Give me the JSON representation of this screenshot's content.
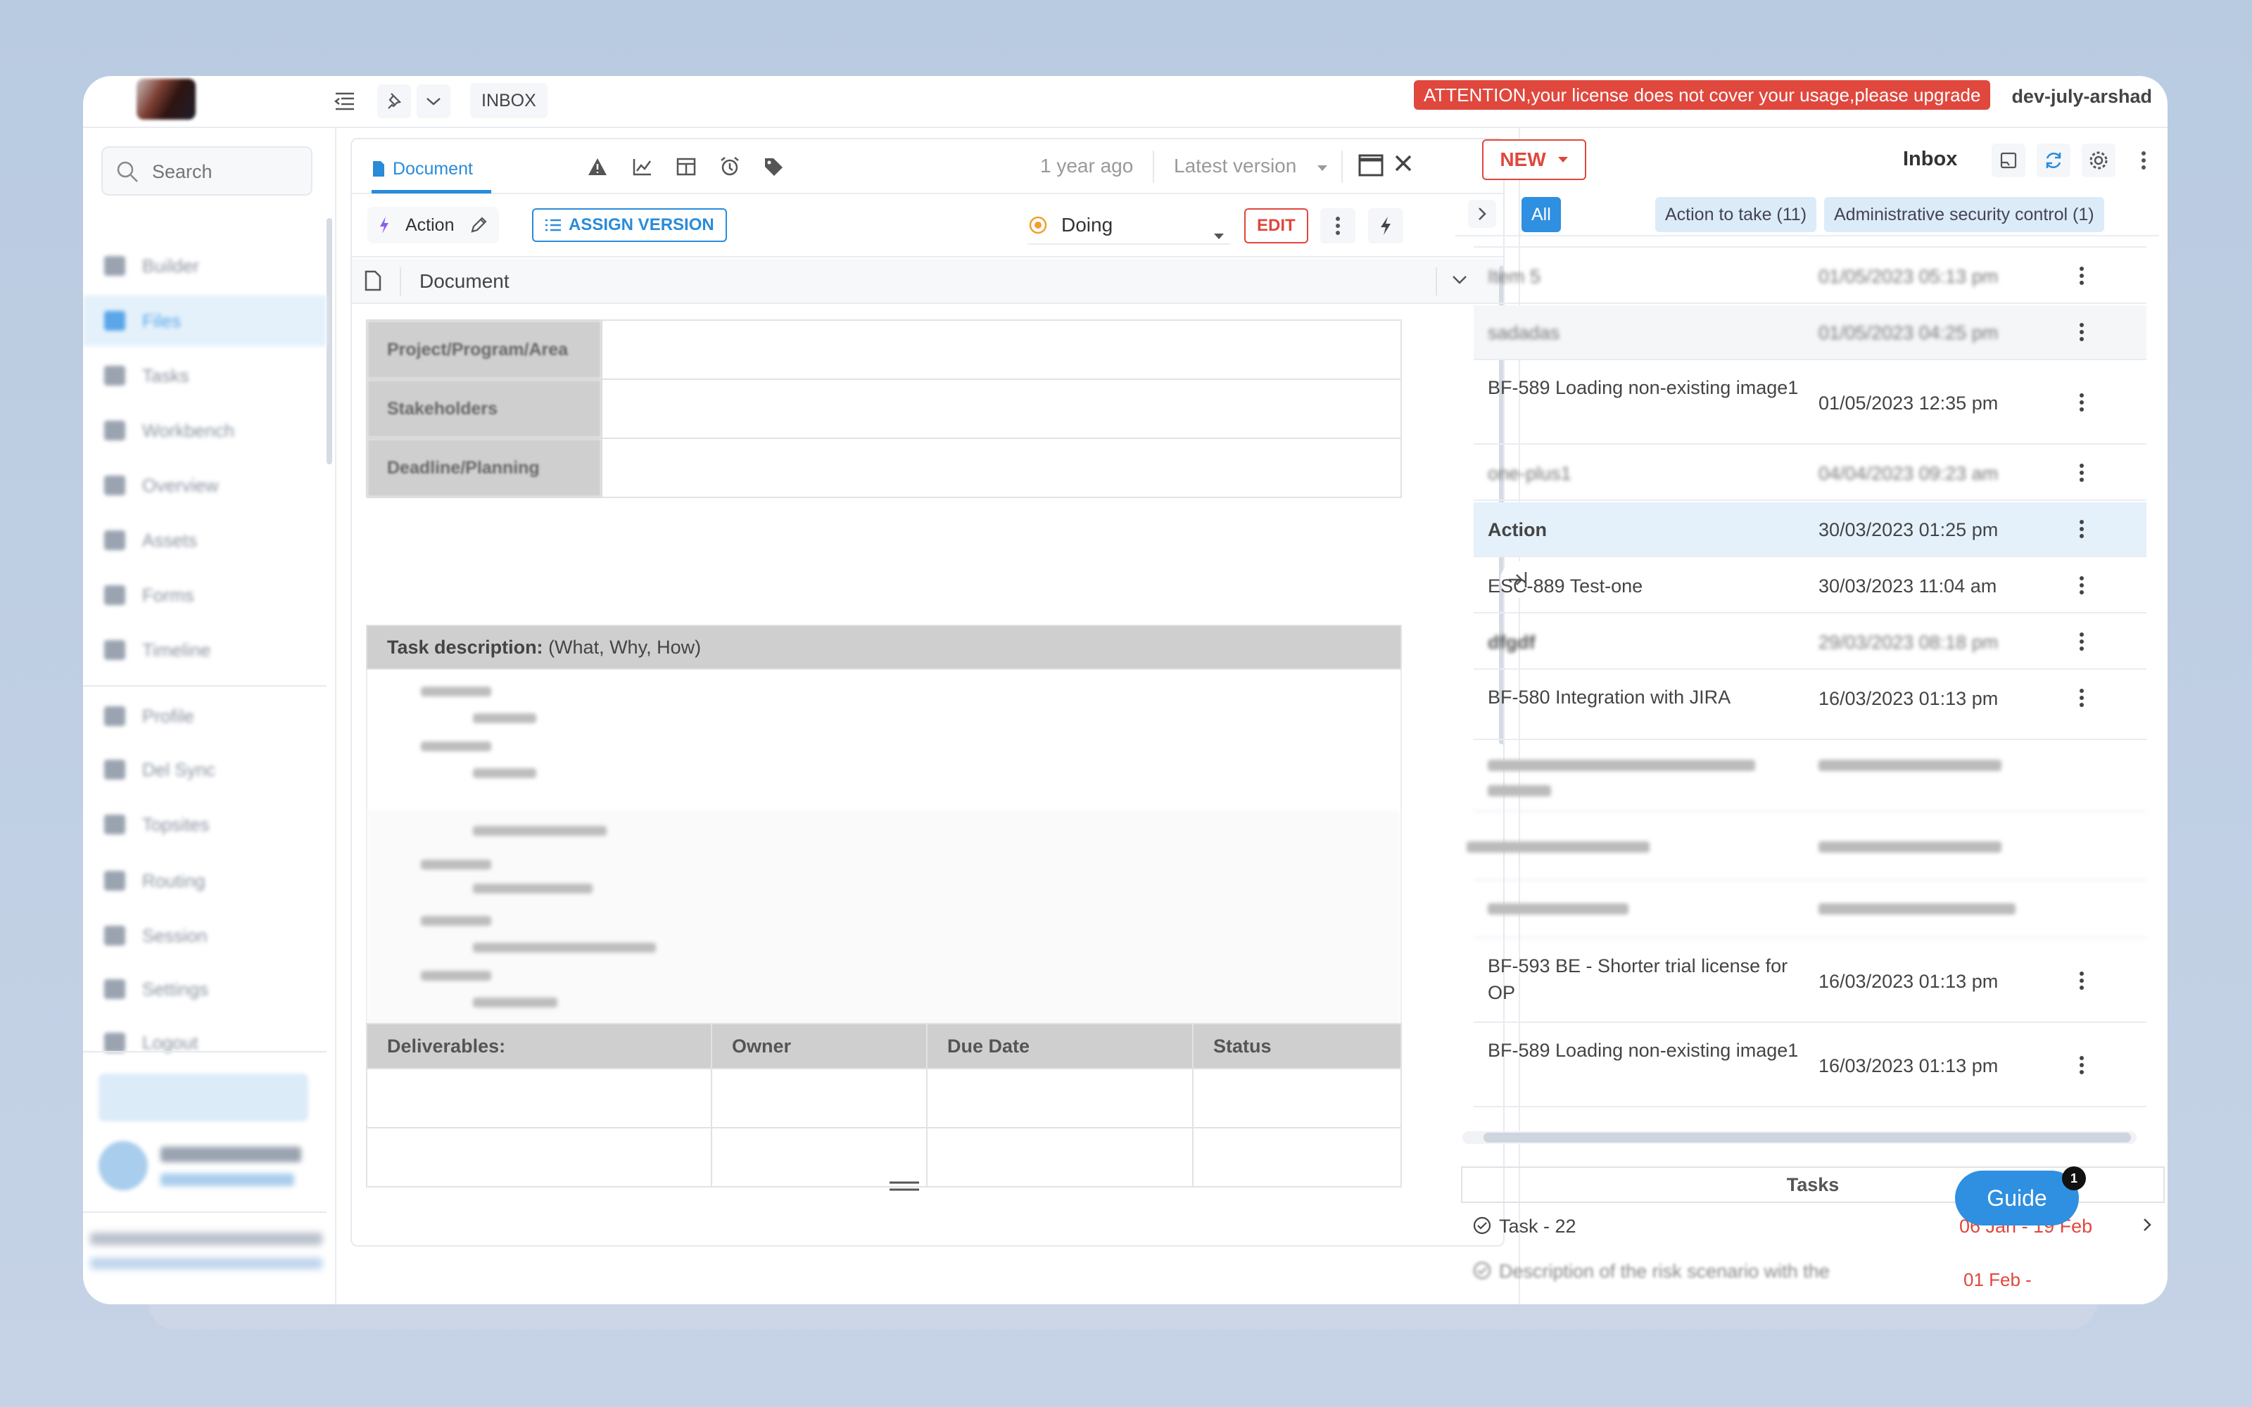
{
  "header": {
    "breadcrumb": "INBOX",
    "license_warning": "ATTENTION,your license does not cover your usage,please upgrade",
    "username": "dev-july-arshad"
  },
  "sidebar": {
    "search_placeholder": "Search",
    "items": [
      {
        "label": "Builder"
      },
      {
        "label": "Files"
      },
      {
        "label": "Tasks"
      },
      {
        "label": "Workbench"
      },
      {
        "label": "Overview"
      },
      {
        "label": "Assets"
      },
      {
        "label": "Forms"
      },
      {
        "label": "Timeline"
      },
      {
        "label": "Profile"
      },
      {
        "label": "Del Sync"
      },
      {
        "label": "Topsites"
      },
      {
        "label": "Routing"
      },
      {
        "label": "Session"
      },
      {
        "label": "Settings"
      },
      {
        "label": "Logout"
      }
    ]
  },
  "document": {
    "tab_label": "Document",
    "updated": "1 year ago",
    "version": "Latest version",
    "action_label": "Action",
    "assign_label": "ASSIGN VERSION",
    "status": "Doing",
    "edit_label": "EDIT",
    "section_title": "Document",
    "property_rows": [
      {
        "label": "Project/Program/Area"
      },
      {
        "label": "Stakeholders"
      },
      {
        "label": "Deadline/Planning"
      }
    ],
    "task_desc_bold": "Task description:",
    "task_desc_rest": " (What, Why, How)",
    "deliverables_headers": [
      "Deliverables:",
      "Owner",
      "Due Date",
      "Status"
    ]
  },
  "inbox": {
    "new_label": "NEW",
    "title": "Inbox",
    "filters": [
      {
        "label": "All",
        "active": true
      },
      {
        "label": "Action to take (11)",
        "active": false
      },
      {
        "label": "Administrative security control (1)",
        "active": false
      }
    ],
    "rows": [
      {
        "name": "Item 5",
        "date": "01/05/2023 05:13 pm",
        "blurred": true
      },
      {
        "name": "sadadas",
        "date": "01/05/2023 04:25 pm",
        "blurred": true
      },
      {
        "name": "BF-589 Loading non-existing image1",
        "date": "01/05/2023 12:35 pm",
        "blurred": false
      },
      {
        "name": "one-plus1",
        "date": "04/04/2023 09:23 am",
        "blurred": true
      },
      {
        "name": "Action",
        "date": "30/03/2023 01:25 pm",
        "blurred": false,
        "selected": true
      },
      {
        "name": "ESC-889 Test-one",
        "date": "30/03/2023 11:04 am",
        "blurred": false
      },
      {
        "name": "dfgdf",
        "date": "29/03/2023 08:18 pm",
        "blurred": true
      },
      {
        "name": "BF-580 Integration with JIRA",
        "date": "16/03/2023 01:13 pm",
        "blurred": false
      },
      {
        "name": "BF-593 BE - Shorter trial license for OP",
        "date": "16/03/2023 01:13 pm",
        "blurred": false
      },
      {
        "name": "BF-589 Loading non-existing image1",
        "date": "16/03/2023 01:13 pm",
        "blurred": false
      }
    ]
  },
  "tasks": {
    "title": "Tasks",
    "items": [
      {
        "name": "Task - 22",
        "date": "06 Jan - 19 Feb"
      },
      {
        "name": "Description of the risk scenario with the",
        "date": "01 Feb -"
      }
    ]
  },
  "guide": {
    "label": "Guide",
    "badge": "1"
  },
  "colors": {
    "accent": "#2f8fe0",
    "danger": "#e0473d",
    "status_doing": "#f0a030"
  }
}
